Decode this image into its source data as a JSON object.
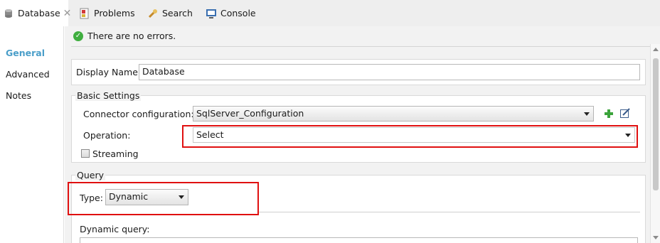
{
  "tabs": [
    {
      "label": "Database",
      "icon": "database-icon",
      "active": true
    },
    {
      "label": "Problems",
      "icon": "problems-icon",
      "active": false
    },
    {
      "label": "Search",
      "icon": "search-icon",
      "active": false
    },
    {
      "label": "Console",
      "icon": "console-icon",
      "active": false
    }
  ],
  "sidebar": {
    "items": [
      {
        "label": "General",
        "active": true
      },
      {
        "label": "Advanced",
        "active": false
      },
      {
        "label": "Notes",
        "active": false
      }
    ]
  },
  "status": {
    "message": "There are no errors."
  },
  "display_name": {
    "label": "Display Name:",
    "value": "Database"
  },
  "basic_settings": {
    "title": "Basic Settings",
    "connector_label": "Connector configuration:",
    "connector_value": "SqlServer_Configuration",
    "operation_label": "Operation:",
    "operation_value": "Select",
    "streaming_label": "Streaming",
    "streaming_checked": false
  },
  "query": {
    "title": "Query",
    "type_label": "Type:",
    "type_value": "Dynamic",
    "dynamic_query_label": "Dynamic query:"
  },
  "colors": {
    "highlight": "#e01010",
    "sidebar_active": "#4a9ec9",
    "ok_icon": "#3fae3f"
  }
}
